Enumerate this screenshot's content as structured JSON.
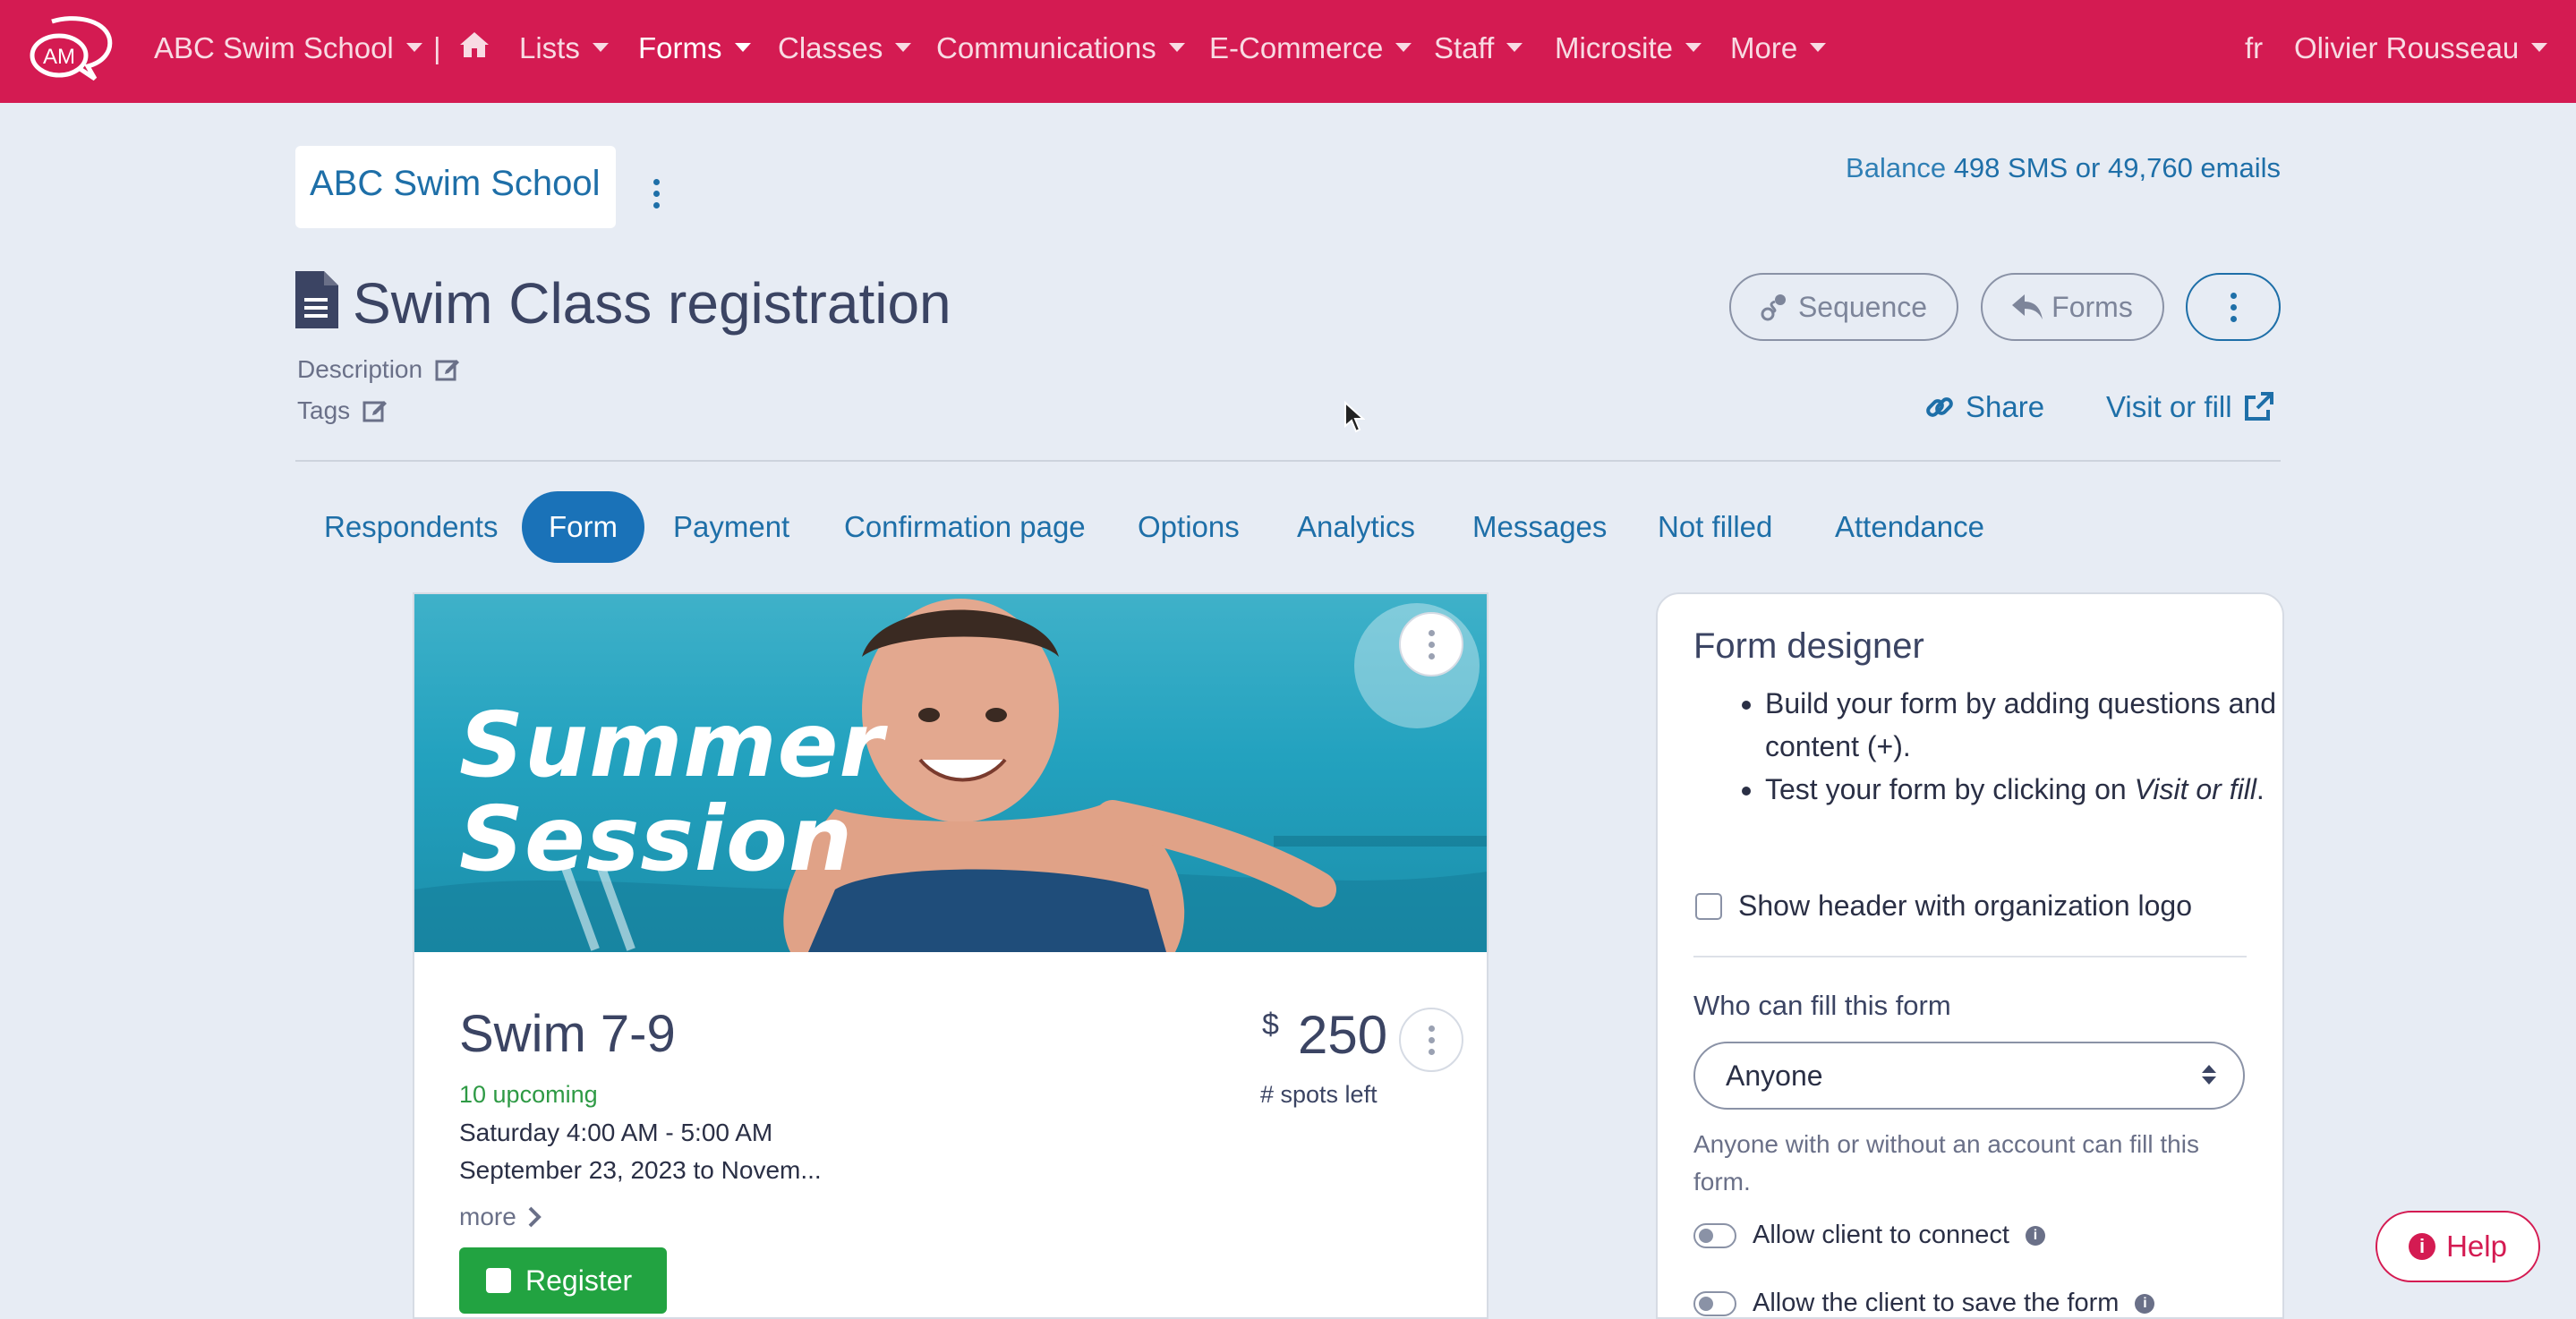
{
  "nav": {
    "logo_text": "AM",
    "org": "ABC Swim School",
    "separator": "|",
    "items": [
      "Lists",
      "Forms",
      "Classes",
      "Communications",
      "E-Commerce",
      "Staff",
      "Microsite",
      "More"
    ],
    "lang": "fr",
    "user": "Olivier Rousseau"
  },
  "header": {
    "org_name": "ABC Swim School",
    "balance_label": "Balance",
    "balance_value": "498 SMS or 49,760 emails",
    "title": "Swim Class registration",
    "description_label": "Description",
    "tags_label": "Tags",
    "sequence_label": "Sequence",
    "forms_label": "Forms",
    "share_label": "Share",
    "visit_label": "Visit or fill"
  },
  "tabs": [
    "Respondents",
    "Form",
    "Payment",
    "Confirmation page",
    "Options",
    "Analytics",
    "Messages",
    "Not filled",
    "Attendance"
  ],
  "preview": {
    "banner_line1": "Summer",
    "banner_line2": "Session",
    "class_title": "Swim 7-9",
    "upcoming": "10 upcoming",
    "schedule": "Saturday 4:00 AM - 5:00 AM",
    "dates": "September 23, 2023 to Novem...",
    "more_label": "more",
    "currency": "$",
    "price": "250",
    "spots_label": "# spots left",
    "register_label": "Register"
  },
  "designer": {
    "title": "Form designer",
    "tip1": "Build your form by adding questions and content (+).",
    "tip2_prefix": "Test your form by clicking on ",
    "tip2_emph": "Visit or fill",
    "tip2_suffix": ".",
    "show_header_label": "Show header with organization logo",
    "who_label": "Who can fill this form",
    "who_value": "Anyone",
    "who_help": "Anyone with or without an account can fill this form.",
    "toggle1": "Allow client to connect",
    "toggle2": "Allow the client to save the form"
  },
  "help_label": "Help",
  "colors": {
    "brand": "#d41b52",
    "accent": "#1a72b8",
    "success": "#22a341"
  }
}
